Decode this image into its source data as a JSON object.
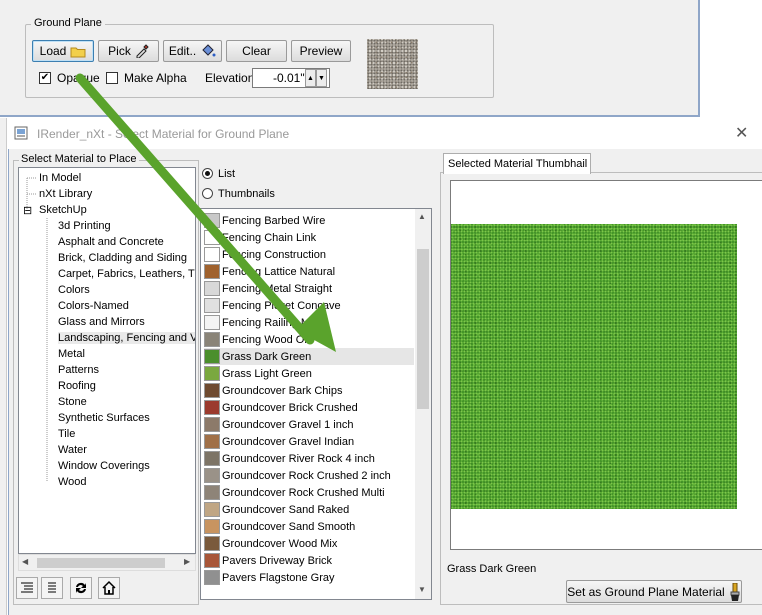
{
  "background_dialog": {
    "ground_plane": {
      "legend": "Ground Plane",
      "buttons": {
        "load": "Load",
        "pick": "Pick",
        "edit": "Edit..",
        "clear": "Clear",
        "preview": "Preview"
      },
      "opaque_label": "Opaque",
      "opaque_checked": true,
      "make_alpha_label": "Make Alpha",
      "make_alpha_checked": false,
      "elevation_label": "Elevation",
      "elevation_value": "-0.01\""
    }
  },
  "window": {
    "title": "IRender_nXt - Select Material for Ground Plane",
    "close_glyph": "✕"
  },
  "tree": {
    "legend": "Select Material to Place",
    "root_items": [
      "In Model",
      "nXt Library"
    ],
    "sketchup": {
      "label": "SketchUp",
      "expander": "⊟",
      "children": [
        "3d Printing",
        "Asphalt and Concrete",
        "Brick, Cladding and Siding",
        "Carpet, Fabrics, Leathers, T",
        "Colors",
        "Colors-Named",
        "Glass and Mirrors",
        "Landscaping, Fencing and Ve",
        "Metal",
        "Patterns",
        "Roofing",
        "Stone",
        "Synthetic Surfaces",
        "Tile",
        "Water",
        "Window Coverings",
        "Wood"
      ]
    },
    "scroll_left": "◀",
    "scroll_right": "▶"
  },
  "view_mode": {
    "list_label": "List",
    "thumbnails_label": "Thumbnails",
    "selected": "List"
  },
  "materials": [
    {
      "name": "Fencing Barbed Wire",
      "swatch": "#c8c8c8"
    },
    {
      "name": "Fencing Chain Link",
      "swatch": "#ffffff"
    },
    {
      "name": "Fencing Construction",
      "swatch": "#ffffff"
    },
    {
      "name": "Fencing Lattice Natural",
      "swatch": "#a0622e"
    },
    {
      "name": "Fencing Metal Straight",
      "swatch": "#d8d8d8"
    },
    {
      "name": "Fencing Picket Concave",
      "swatch": "#e0e0e0"
    },
    {
      "name": "Fencing Railing Metal",
      "swatch": "#f4f4f4"
    },
    {
      "name": "Fencing Wood Old",
      "swatch": "#8a8478"
    },
    {
      "name": "Grass Dark Green",
      "swatch": "#4b8f2c"
    },
    {
      "name": "Grass Light Green",
      "swatch": "#7aa83f"
    },
    {
      "name": "Groundcover Bark Chips",
      "swatch": "#6e4a30"
    },
    {
      "name": "Groundcover Brick Crushed",
      "swatch": "#9b3a2e"
    },
    {
      "name": "Groundcover Gravel 1 inch",
      "swatch": "#8c7a6a"
    },
    {
      "name": "Groundcover Gravel Indian",
      "swatch": "#a07048"
    },
    {
      "name": "Groundcover River Rock 4 inch",
      "swatch": "#7d7466"
    },
    {
      "name": "Groundcover Rock Crushed 2 inch",
      "swatch": "#9a9288"
    },
    {
      "name": "Groundcover Rock Crushed Multi",
      "swatch": "#8e8478"
    },
    {
      "name": "Groundcover Sand Raked",
      "swatch": "#c0a684"
    },
    {
      "name": "Groundcover Sand Smooth",
      "swatch": "#c89460"
    },
    {
      "name": "Groundcover Wood Mix",
      "swatch": "#7a5a3c"
    },
    {
      "name": "Pavers Driveway Brick",
      "swatch": "#a85638"
    },
    {
      "name": "Pavers Flagstone Gray",
      "swatch": "#909090"
    }
  ],
  "selected_material": "Grass Dark Green",
  "thumbnail_panel": {
    "tab_label": "Selected Material Thumbhail",
    "caption": "Grass Dark Green",
    "set_button_label": "Set as Ground Plane Material"
  },
  "annotation": {
    "arrow_color": "#5aa32c"
  }
}
